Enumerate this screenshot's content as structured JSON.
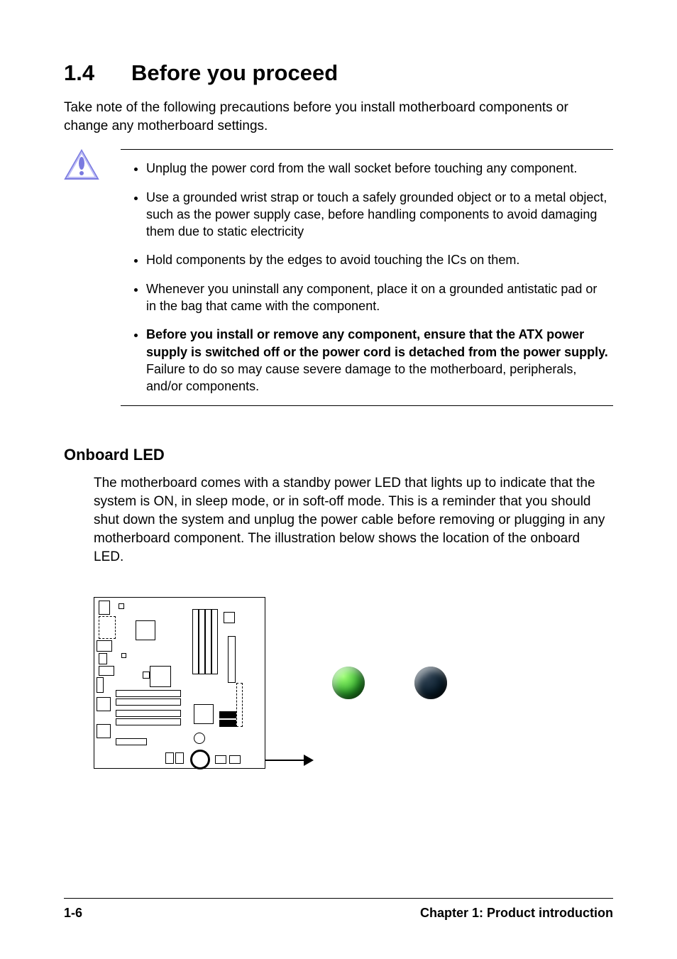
{
  "heading": {
    "number": "1.4",
    "title": "Before you proceed"
  },
  "intro": "Take note of the following precautions before you install motherboard components or change any motherboard settings.",
  "bullets": {
    "b1": "Unplug the power cord from the wall socket before touching any component.",
    "b2": "Use a grounded wrist strap or touch  a safely grounded object or to a metal object, such as the power supply case, before handling components to avoid damaging them due to static electricity",
    "b3": "Hold components by the edges to avoid touching the ICs on them.",
    "b4": "Whenever you uninstall any component, place it on a grounded antistatic pad or in the bag that came with the component.",
    "b5_bold": "Before you install or remove any component, ensure that the ATX power supply is switched off or the power cord is detached from the power supply.",
    "b5_tail": " Failure to do so may cause severe damage to the motherboard, peripherals, and/or components."
  },
  "onboard": {
    "heading": "Onboard LED",
    "body": "The motherboard comes with a standby power LED that lights up  to indicate that the system is ON, in sleep mode, or in soft-off mode. This is a reminder that you should shut down the system and unplug the power cable before removing or plugging in any motherboard component. The illustration below shows the location of the onboard LED."
  },
  "footer": {
    "left": "1-6",
    "right": "Chapter 1: Product introduction"
  }
}
